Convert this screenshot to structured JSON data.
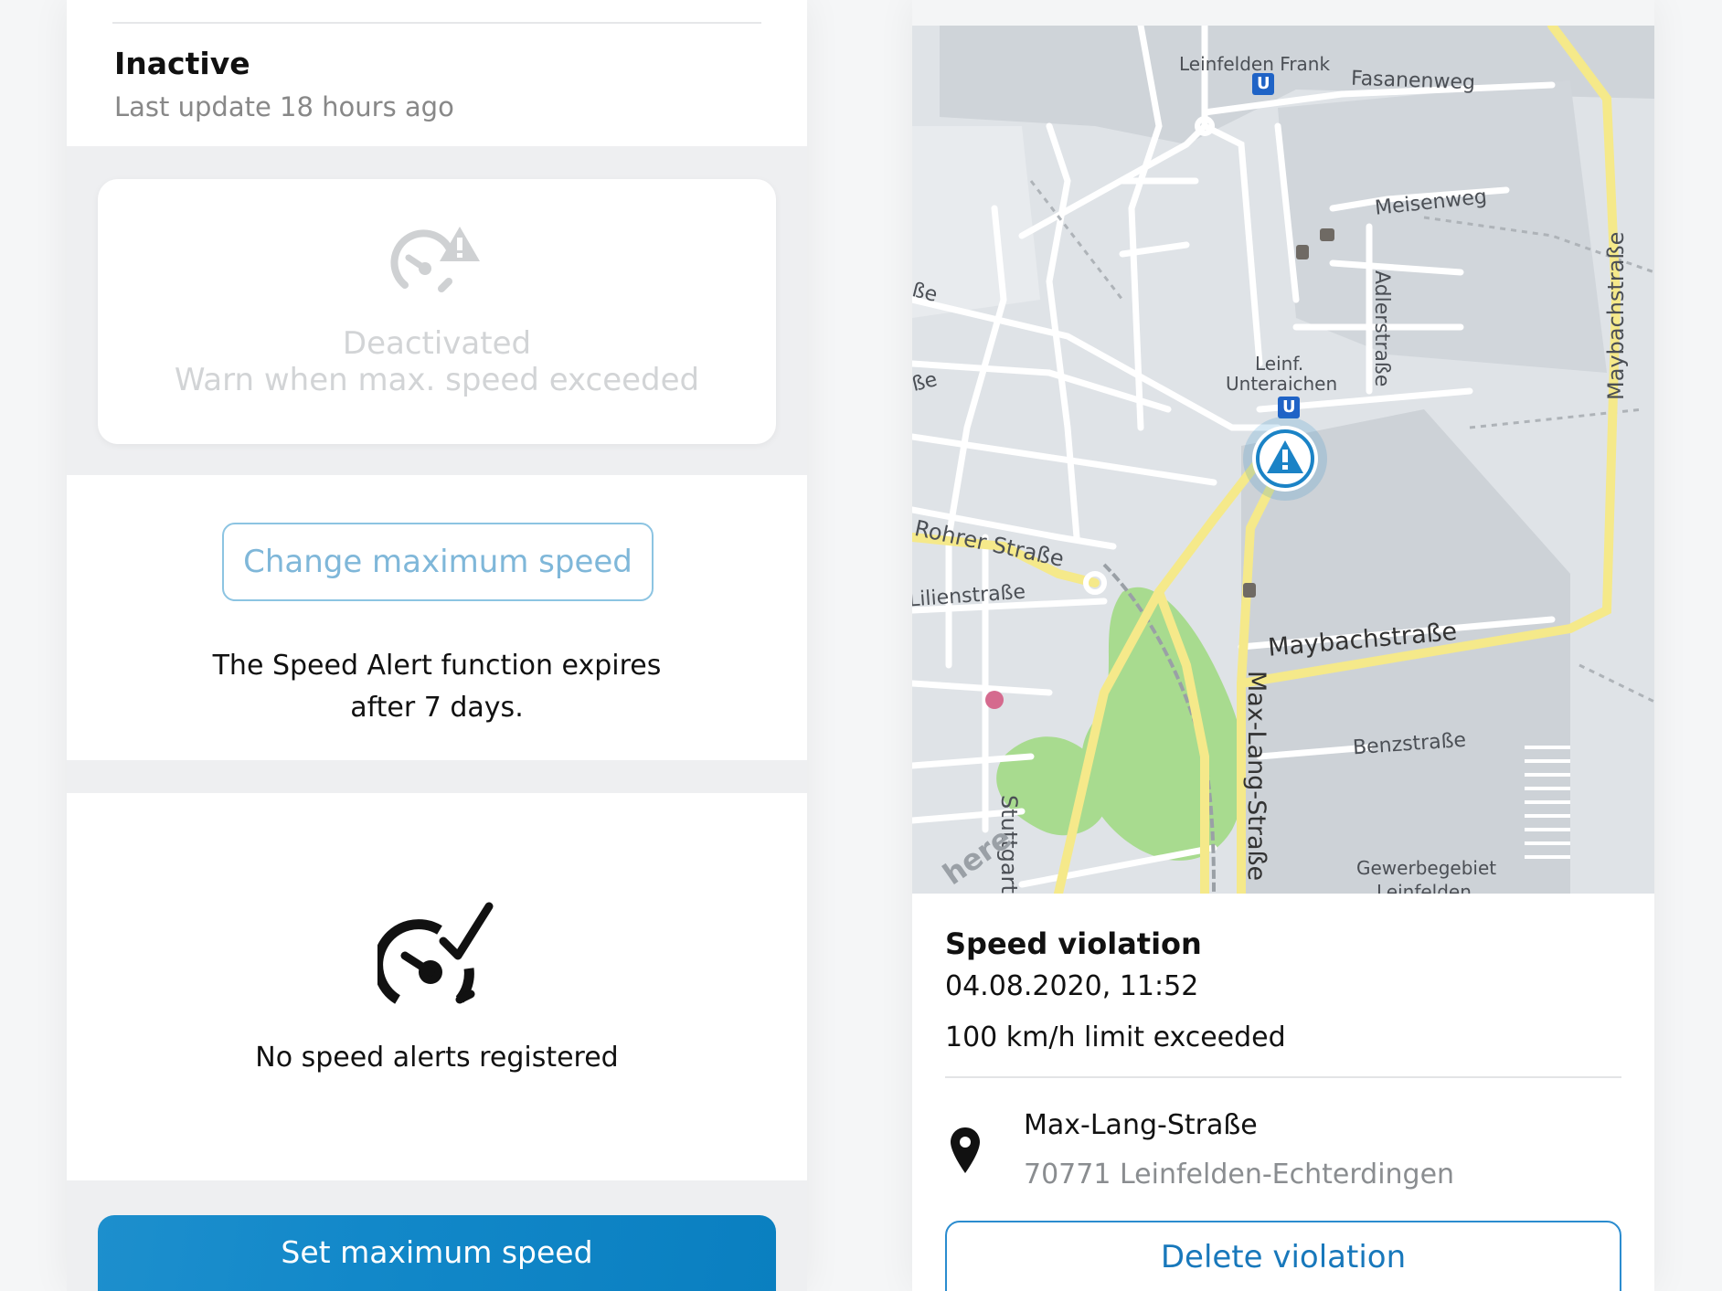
{
  "left": {
    "status": {
      "title": "Inactive",
      "subtitle": "Last update 18 hours ago"
    },
    "deactivated_card": {
      "icon": "speedometer-warning-icon",
      "line1": "Deactivated",
      "line2": "Warn when max. speed exceeded"
    },
    "change_button_label": "Change maximum speed",
    "expire_line1": "The Speed Alert function expires",
    "expire_line2": "after 7 days.",
    "no_alerts": {
      "icon": "speedometer-check-icon",
      "text": "No speed alerts registered"
    },
    "set_button_label": "Set maximum speed"
  },
  "right": {
    "map": {
      "labels": {
        "leinfelden_frank": "Leinfelden Frank",
        "fasanenweg": "Fasanenweg",
        "meisenweg": "Meisenweg",
        "adlerstrasse": "Adlerstraße",
        "maybachstrasse_vertical": "Maybachstraße",
        "leinf": "Leinf.",
        "unteraichen": "Unteraichen",
        "rohrer_strasse": "Rohrer Straße",
        "lilienstrasse": "Lilienstraße",
        "maybachstrasse": "Maybachstraße",
        "max_lang_strasse": "Max-Lang-Straße",
        "benzstrasse": "Benzstraße",
        "stuttgart": "Stuttgart",
        "gewerbegebiet": "Gewerbegebiet",
        "leinfelden_cut": "Leinfelden",
        "be": "ße",
        "sse": "ße",
        "here_logo": "here",
        "ubahn": "U"
      },
      "colors": {
        "major_road": "#f5e98a",
        "park": "#a8db8f",
        "marker": "#1b83c6"
      }
    },
    "violation": {
      "title": "Speed violation",
      "date": "04.08.2020, 11:52",
      "limit": "100 km/h limit exceeded",
      "street": "Max-Lang-Straße",
      "city": "70771 Leinfelden-Echterdingen"
    },
    "delete_button_label": "Delete violation"
  }
}
